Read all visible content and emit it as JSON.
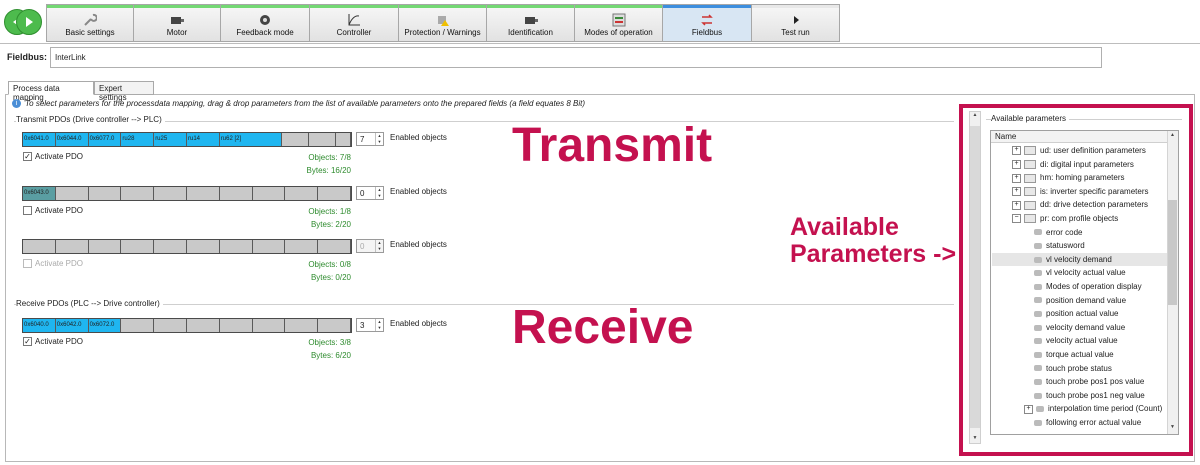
{
  "toolbar": {
    "tabs": [
      {
        "label": "Basic settings",
        "icon": "wrench-icon"
      },
      {
        "label": "Motor",
        "icon": "motor-icon"
      },
      {
        "label": "Feedback mode",
        "icon": "encoder-icon"
      },
      {
        "label": "Controller",
        "icon": "graph-icon"
      },
      {
        "label": "Protection / Warnings",
        "icon": "warning-icon"
      },
      {
        "label": "Identification",
        "icon": "motor-id-icon"
      },
      {
        "label": "Modes of operation",
        "icon": "modes-icon"
      },
      {
        "label": "Fieldbus",
        "icon": "fieldbus-icon"
      },
      {
        "label": "Test run",
        "icon": "play-icon"
      }
    ],
    "active_tab": "Fieldbus"
  },
  "fieldbus": {
    "label": "Fieldbus:",
    "value": "InterLink"
  },
  "subtabs": [
    "Process data mapping",
    "Expert settings"
  ],
  "info_text": "To select parameters for the processdata mapping, drag & drop parameters from the list of available parameters onto the prepared fields (a field equates 8 Bit)",
  "transmit": {
    "title": "Transmit PDOs (Drive controller --> PLC)",
    "pdos": [
      {
        "cells": [
          "0x6041.0",
          "0x6044.0",
          "0x6077.0",
          "ru28",
          "ru25",
          "ru14",
          "ru62 [2]"
        ],
        "enabled_count": "7",
        "enabled_label": "Enabled objects",
        "activate_label": "Activate PDO",
        "activated": true,
        "objects": "Objects: 7/8",
        "bytes": "Bytes: 16/20"
      },
      {
        "cells": [
          "0x6043.0"
        ],
        "enabled_count": "0",
        "enabled_label": "Enabled objects",
        "activate_label": "Activate PDO",
        "activated": false,
        "objects": "Objects: 1/8",
        "bytes": "Bytes: 2/20"
      },
      {
        "cells": [],
        "enabled_count": "0",
        "enabled_label": "Enabled objects",
        "activate_label": "Activate PDO",
        "activated": false,
        "objects": "Objects: 0/8",
        "bytes": "Bytes: 0/20"
      }
    ]
  },
  "receive": {
    "title": "Receive PDOs (PLC --> Drive controller)",
    "pdos": [
      {
        "cells": [
          "0x6040.0",
          "0x6042.0",
          "0x6072.0"
        ],
        "enabled_count": "3",
        "enabled_label": "Enabled objects",
        "activate_label": "Activate PDO",
        "activated": true,
        "objects": "Objects: 3/8",
        "bytes": "Bytes: 6/20"
      }
    ]
  },
  "overlay": {
    "transmit": "Transmit",
    "receive": "Receive",
    "available_line1": "Available",
    "available_line2": "Parameters ->"
  },
  "available": {
    "title": "Available parameters",
    "column": "Name",
    "items": [
      {
        "label": "ud: user definition parameters",
        "type": "folder"
      },
      {
        "label": "di: digital input parameters",
        "type": "folder"
      },
      {
        "label": "hm: homing parameters",
        "type": "folder"
      },
      {
        "label": "is: inverter specific parameters",
        "type": "folder"
      },
      {
        "label": "dd: drive detection parameters",
        "type": "folder"
      },
      {
        "label": "pr: com profile objects",
        "type": "open-folder"
      },
      {
        "label": "error code",
        "type": "leaf"
      },
      {
        "label": "statusword",
        "type": "leaf"
      },
      {
        "label": "vl velocity demand",
        "type": "leaf"
      },
      {
        "label": "vl velocity actual value",
        "type": "leaf"
      },
      {
        "label": "Modes of operation display",
        "type": "leaf"
      },
      {
        "label": "position demand value",
        "type": "leaf"
      },
      {
        "label": "position actual value",
        "type": "leaf"
      },
      {
        "label": "velocity demand value",
        "type": "leaf"
      },
      {
        "label": "velocity actual value",
        "type": "leaf"
      },
      {
        "label": "torque actual value",
        "type": "leaf"
      },
      {
        "label": "touch probe status",
        "type": "leaf"
      },
      {
        "label": "touch probe pos1 pos value",
        "type": "leaf"
      },
      {
        "label": "touch probe pos1 neg value",
        "type": "leaf"
      },
      {
        "label": "interpolation time period (Count)",
        "type": "sub-folder"
      },
      {
        "label": "following error actual value",
        "type": "leaf"
      }
    ],
    "selected": "vl velocity demand"
  }
}
